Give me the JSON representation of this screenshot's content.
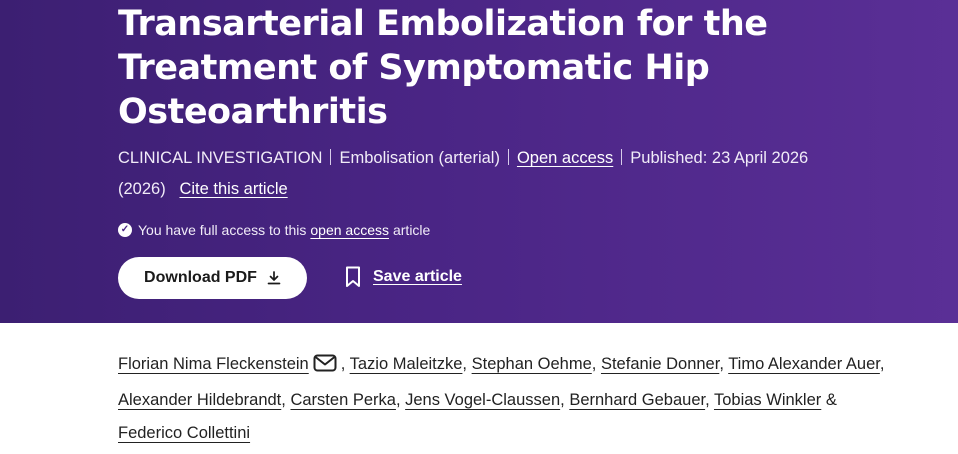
{
  "article": {
    "title": "Transarterial Embolization for the Treatment of Symptomatic Hip Osteoarthritis",
    "type": "CLINICAL INVESTIGATION",
    "category": "Embolisation (arterial)",
    "open_access": "Open access",
    "published": "Published: 23 April 2026",
    "year": "(2026)",
    "cite": "Cite this article"
  },
  "access": {
    "prefix": "You have full access to this",
    "link": "open access",
    "suffix": "article"
  },
  "actions": {
    "download": "Download PDF",
    "save": "Save article"
  },
  "authors": {
    "list": [
      "Florian Nima Fleckenstein",
      "Tazio Maleitzke",
      "Stephan Oehme",
      "Stefanie Donner",
      "Timo Alexander Auer",
      "Alexander Hildebrandt",
      "Carsten Perka",
      "Jens Vogel-Claussen",
      "Bernhard Gebauer",
      "Tobias Winkler",
      "Federico Collettini"
    ],
    "comma": ",",
    "amp": "&"
  },
  "colors": {
    "hero_start": "#3c1f72",
    "hero_end": "#5a2f96",
    "button_bg": "#ffffff"
  },
  "icons": {
    "check": "check-circle-icon",
    "download": "download-icon",
    "bookmark": "bookmark-icon",
    "mail": "mail-icon"
  }
}
